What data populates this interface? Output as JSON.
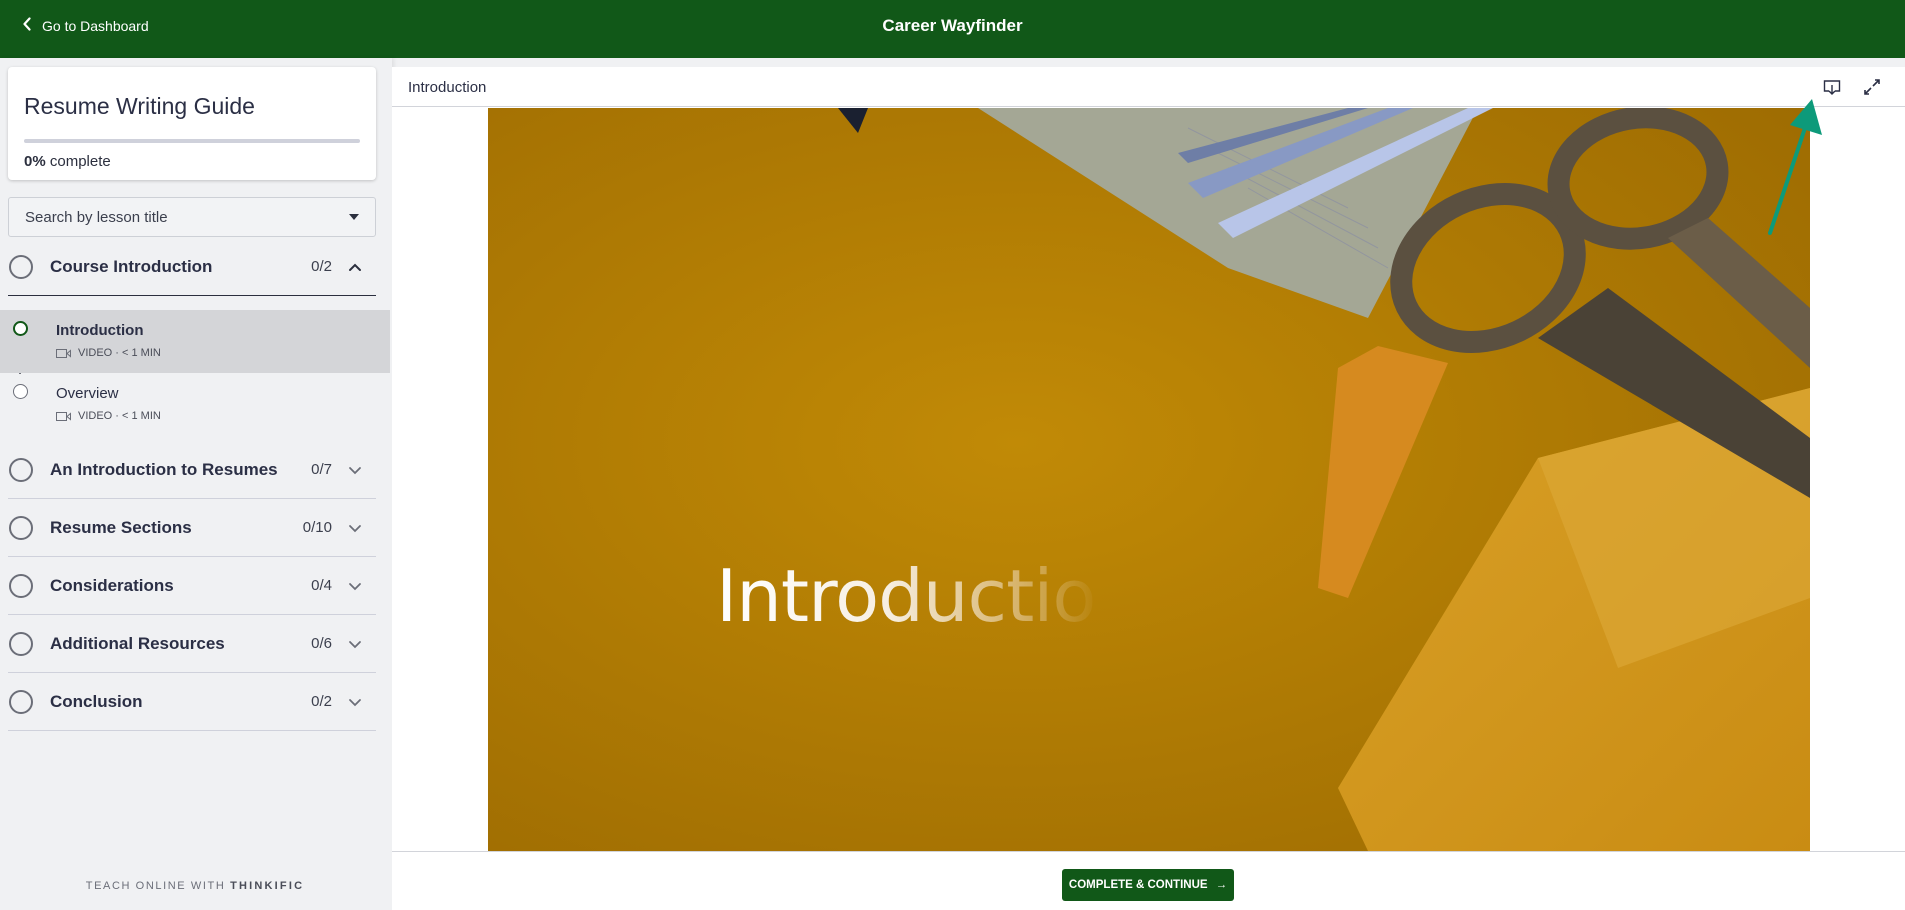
{
  "topbar": {
    "back_label": "Go to Dashboard",
    "app_title": "Career Wayfinder",
    "brand_color": "#115818"
  },
  "course": {
    "title": "Resume Writing Guide",
    "progress_percent": 0,
    "progress_value": "0%",
    "progress_suffix": "complete"
  },
  "search": {
    "placeholder": "Search by lesson title"
  },
  "chapters": [
    {
      "title": "Course Introduction",
      "count": "0/2",
      "expanded": true,
      "lessons": [
        {
          "title": "Introduction",
          "type": "VIDEO",
          "duration": "< 1 MIN",
          "meta": "VIDEO · < 1 MIN",
          "active": true
        },
        {
          "title": "Overview",
          "type": "VIDEO",
          "duration": "< 1 MIN",
          "meta": "VIDEO · < 1 MIN",
          "active": false
        }
      ]
    },
    {
      "title": "An Introduction to Resumes",
      "count": "0/7",
      "expanded": false
    },
    {
      "title": "Resume Sections",
      "count": "0/10",
      "expanded": false
    },
    {
      "title": "Considerations",
      "count": "0/4",
      "expanded": false
    },
    {
      "title": "Additional Resources",
      "count": "0/6",
      "expanded": false
    },
    {
      "title": "Conclusion",
      "count": "0/2",
      "expanded": false
    }
  ],
  "footer": {
    "prefix": "TEACH ONLINE WITH ",
    "brand": "THINKIFIC"
  },
  "lesson": {
    "header_title": "Introduction",
    "video_overlay_text": "Introductio",
    "download_icon": "download-icon",
    "fullscreen_icon": "fullscreen-icon"
  },
  "footer_bar": {
    "complete_button": "COMPLETE & CONTINUE",
    "arrow": "→"
  },
  "annotation": {
    "color": "#0d9a7a"
  }
}
